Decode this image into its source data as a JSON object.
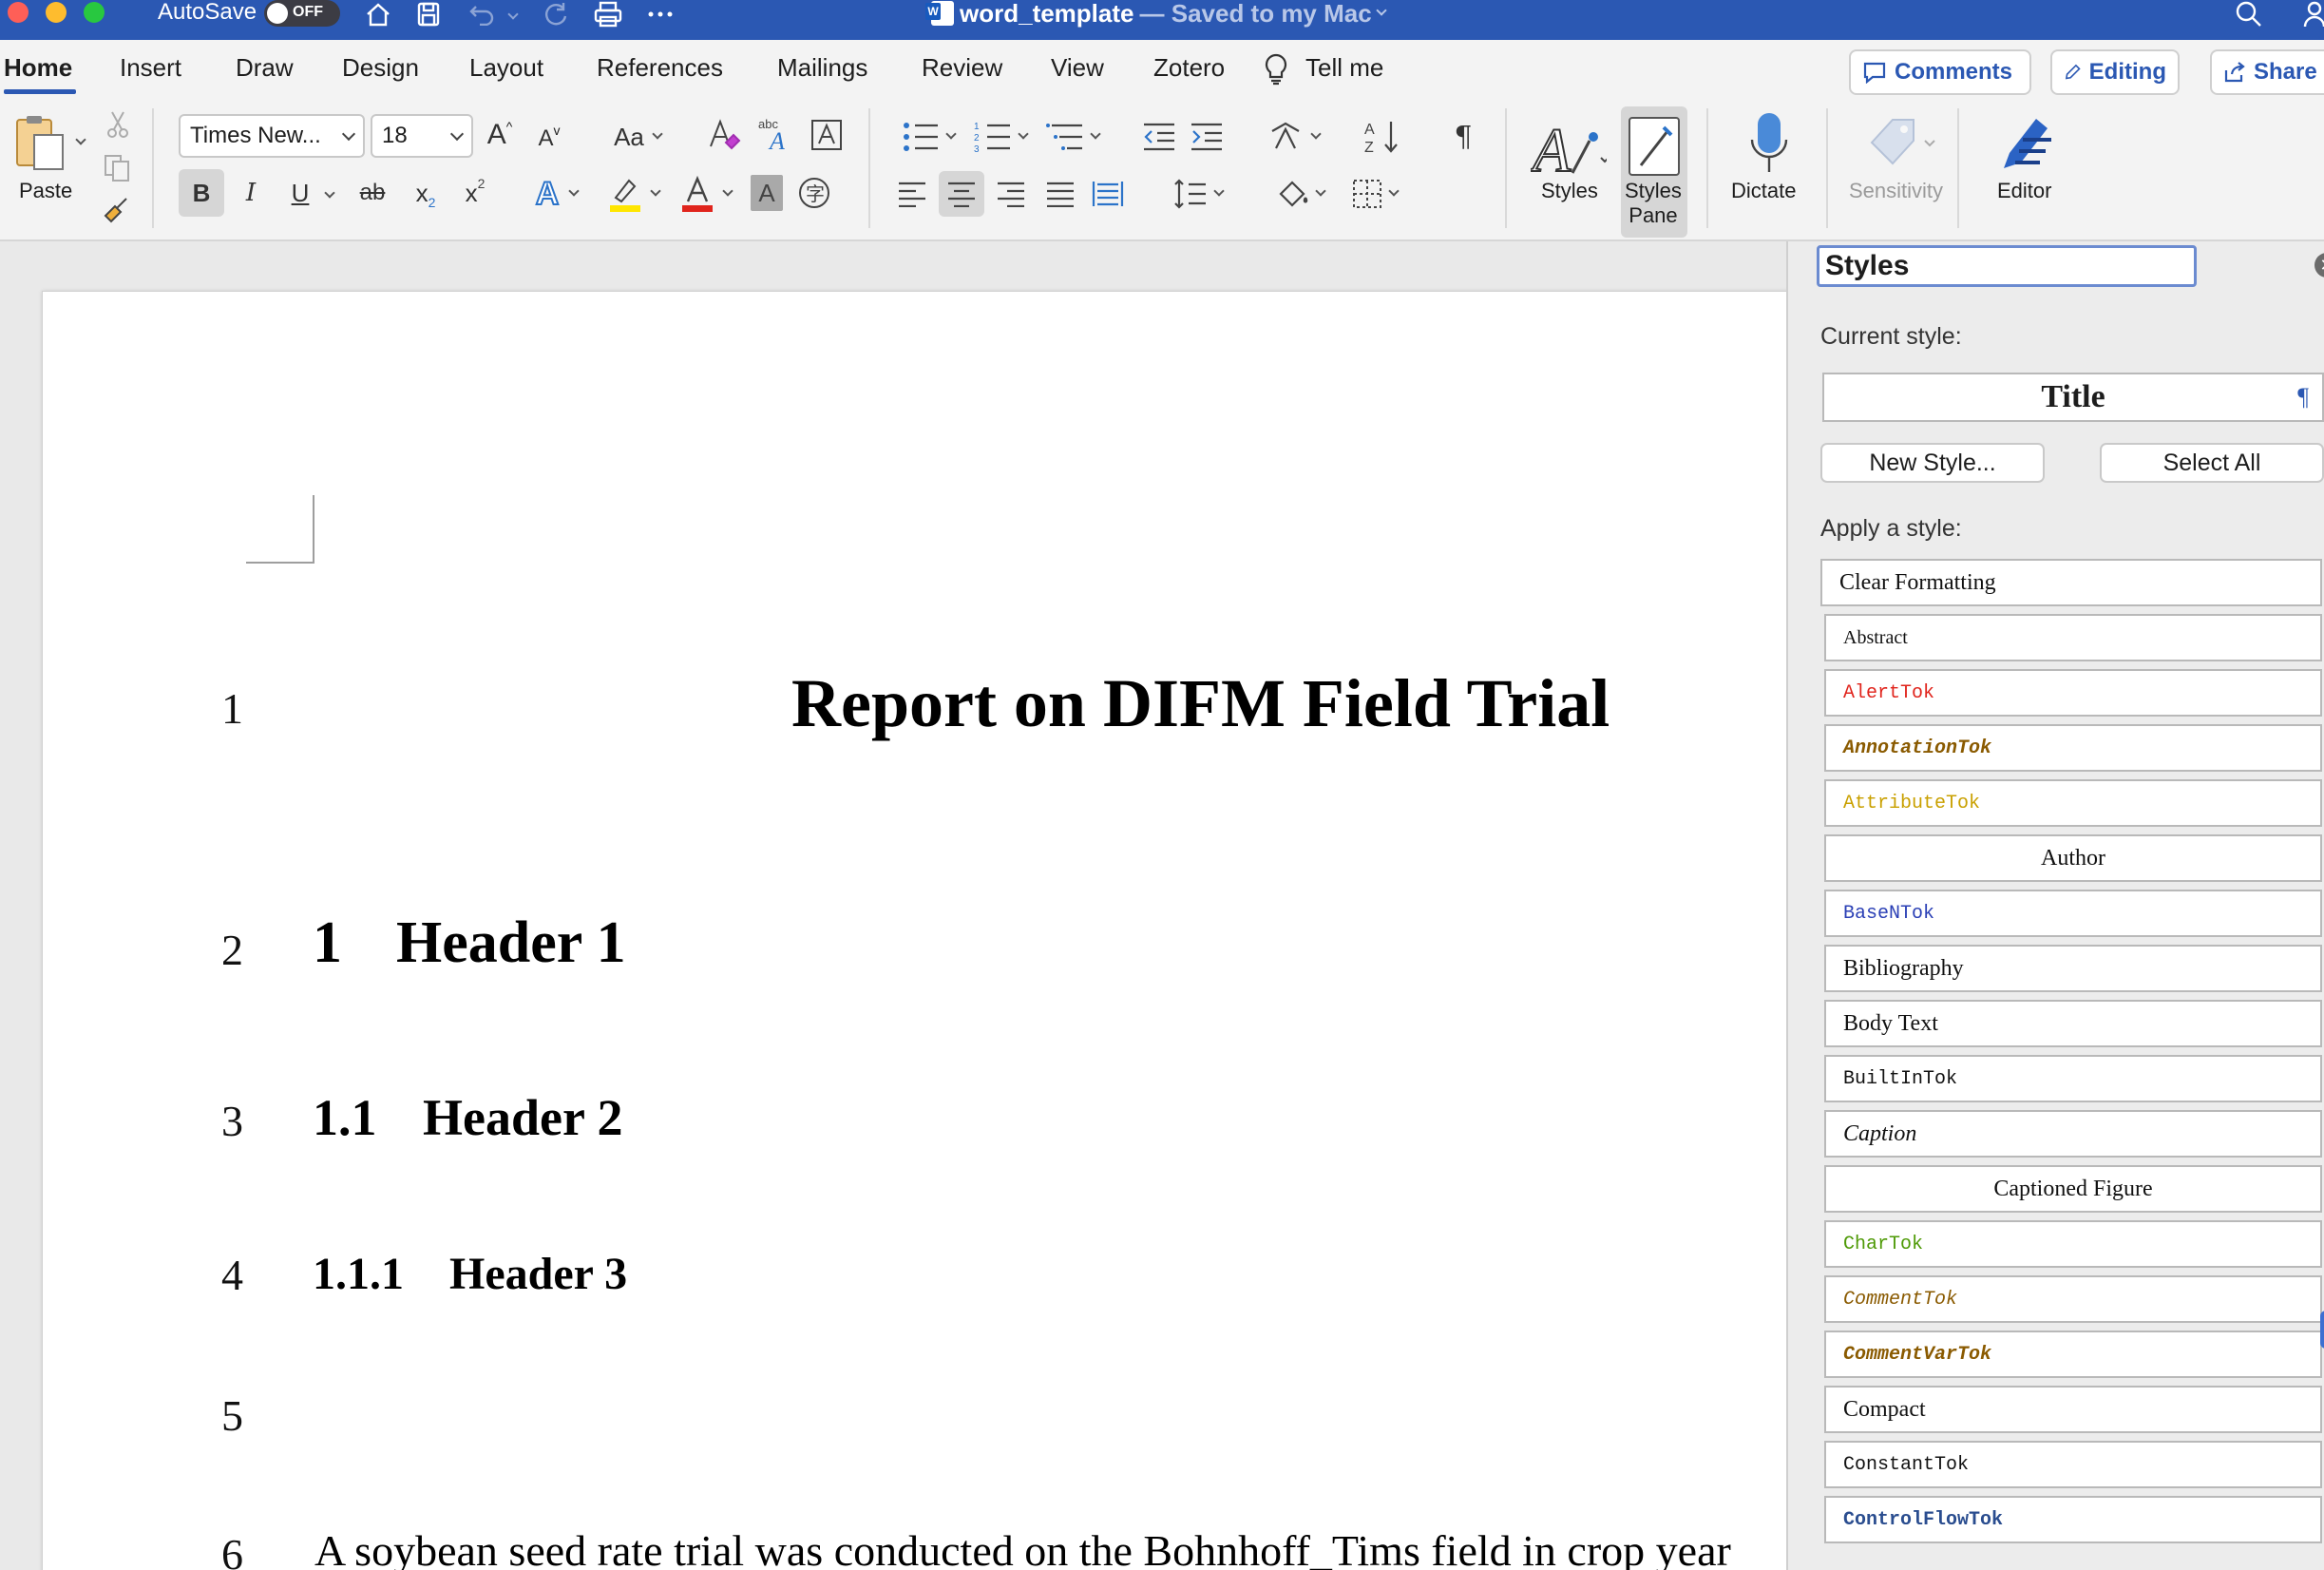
{
  "titlebar": {
    "autosave_label": "AutoSave",
    "autosave_state": "OFF",
    "doc_name": "word_template",
    "doc_status": "— Saved to my Mac"
  },
  "tabs": [
    {
      "label": "Home",
      "active": true
    },
    {
      "label": "Insert"
    },
    {
      "label": "Draw"
    },
    {
      "label": "Design"
    },
    {
      "label": "Layout"
    },
    {
      "label": "References"
    },
    {
      "label": "Mailings"
    },
    {
      "label": "Review"
    },
    {
      "label": "View"
    },
    {
      "label": "Zotero"
    },
    {
      "label": "Tell me"
    }
  ],
  "right_buttons": {
    "comments": "Comments",
    "editing": "Editing",
    "share": "Share"
  },
  "ribbon": {
    "paste_label": "Paste",
    "font_name": "Times New...",
    "font_size": "18",
    "styles_label": "Styles",
    "styles_pane_label_1": "Styles",
    "styles_pane_label_2": "Pane",
    "dictate_label": "Dictate",
    "sensitivity_label": "Sensitivity",
    "editor_label": "Editor",
    "bold_glyph": "B",
    "italic_glyph": "I",
    "underline_glyph": "U",
    "strike_glyph": "ab",
    "subscript_glyph": "x",
    "superscript_glyph": "x",
    "case_glyph": "Aa",
    "grow_glyph": "A",
    "shrink_glyph": "A",
    "pilcrow_glyph": "¶",
    "sort_glyph": "AZ"
  },
  "document": {
    "line_numbers": [
      "1",
      "2",
      "3",
      "4",
      "5",
      "6"
    ],
    "title": "Report on DIFM Field Trial",
    "h1_num": "1",
    "h1_text": "Header 1",
    "h2_num": "1.1",
    "h2_text": "Header 2",
    "h3_num": "1.1.1",
    "h3_text": "Header 3",
    "body": "A soybean seed rate trial was conducted on the Bohnhoff_Tims field in crop year"
  },
  "styles_pane": {
    "title": "Styles",
    "current_style_label": "Current style:",
    "current_style": "Title",
    "new_style_button": "New Style...",
    "select_all_button": "Select All",
    "apply_label": "Apply a style:",
    "items": [
      {
        "name": "Clear Formatting",
        "font": "serif",
        "color": "#111111"
      },
      {
        "name": "Abstract",
        "font": "serif-small",
        "color": "#111111"
      },
      {
        "name": "AlertTok",
        "font": "mono",
        "color": "#e0241c"
      },
      {
        "name": "AnnotationTok",
        "font": "mono-bold-italic",
        "color": "#8a5a00"
      },
      {
        "name": "AttributeTok",
        "font": "mono",
        "color": "#c9a000"
      },
      {
        "name": "Author",
        "font": "serif-center",
        "color": "#111111"
      },
      {
        "name": "BaseNTok",
        "font": "mono",
        "color": "#2a3fb5"
      },
      {
        "name": "Bibliography",
        "font": "serif",
        "color": "#111111"
      },
      {
        "name": "Body Text",
        "font": "serif",
        "color": "#111111"
      },
      {
        "name": "BuiltInTok",
        "font": "mono",
        "color": "#111111"
      },
      {
        "name": "Caption",
        "font": "serif-italic",
        "color": "#111111"
      },
      {
        "name": "Captioned Figure",
        "font": "serif-center",
        "color": "#111111"
      },
      {
        "name": "CharTok",
        "font": "mono",
        "color": "#4e9a06"
      },
      {
        "name": "CommentTok",
        "font": "mono-italic",
        "color": "#8a5a00"
      },
      {
        "name": "CommentVarTok",
        "font": "mono-bold-italic",
        "color": "#8a5a00"
      },
      {
        "name": "Compact",
        "font": "serif",
        "color": "#111111"
      },
      {
        "name": "ConstantTok",
        "font": "mono",
        "color": "#111111"
      },
      {
        "name": "ControlFlowTok",
        "font": "mono-bold",
        "color": "#2a4d8f"
      }
    ]
  },
  "colors": {
    "titlebar_bg": "#2b58b3",
    "accent": "#2b58b3",
    "highlight_yellow": "#ffe600",
    "font_color_red": "#e0241c"
  }
}
